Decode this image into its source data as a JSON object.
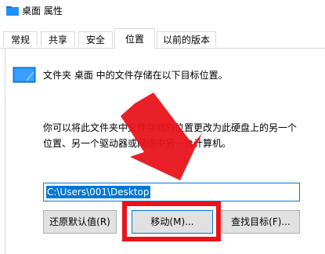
{
  "window": {
    "title": "桌面 属性"
  },
  "tabs": [
    {
      "label": "常规"
    },
    {
      "label": "共享"
    },
    {
      "label": "安全"
    },
    {
      "label": "位置"
    },
    {
      "label": "以前的版本"
    }
  ],
  "location": {
    "description": "文件夹 桌面 中的文件存储在以下目标位置。",
    "info_line1": "你可以将此文件夹中文件存储的位置更改为此硬盘上的另一个",
    "info_line2": "位置、另一个驱动器或网络中另一台计算机。",
    "path_value": "C:\\Users\\001\\Desktop"
  },
  "buttons": {
    "restore_default": "还原默认值(R)",
    "move": "移动(M)...",
    "find_target": "查找目标(F)..."
  },
  "icons": {
    "title_folder": "folder-icon",
    "desktop_folder": "desktop-folder-icon"
  },
  "colors": {
    "selection": "#0078d7",
    "annotation_red": "#e8141b"
  }
}
